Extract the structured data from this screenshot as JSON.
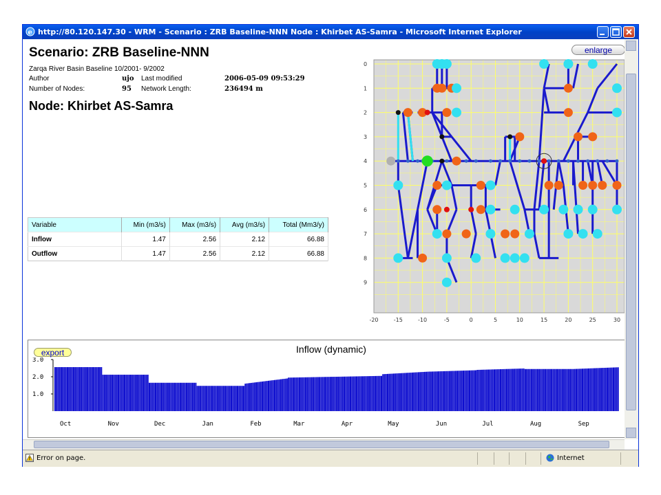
{
  "window": {
    "title": "http://80.120.147.30 - WRM - Scenario : ZRB Baseline-NNN Node : Khirbet AS-Samra - Microsoft Internet Explorer"
  },
  "scenario": {
    "heading": "Scenario: ZRB Baseline-NNN",
    "subtitle": "Zarqa River Basin Baseline 10/2001- 9/2002",
    "author_label": "Author",
    "author": "ujo",
    "last_modified_label": "Last modified",
    "last_modified": "2006-05-09 09:53:29",
    "nodes_label": "Number of Nodes:",
    "nodes": "95",
    "network_length_label": "Network Length:",
    "network_length": "236494 m"
  },
  "node": {
    "heading": "Node: Khirbet AS-Samra"
  },
  "stats_table": {
    "headers": [
      "Variable",
      "Min (m3/s)",
      "Max (m3/s)",
      "Avg (m3/s)",
      "Total (Mm3/y)"
    ],
    "rows": [
      [
        "Inflow",
        "1.47",
        "2.56",
        "2.12",
        "66.88"
      ],
      [
        "Outflow",
        "1.47",
        "2.56",
        "2.12",
        "66.88"
      ]
    ]
  },
  "map": {
    "enlarge_label": "enlarge",
    "x_ticks": [
      "-20",
      "-15",
      "-10",
      "-5",
      "0",
      "5",
      "10",
      "15",
      "20",
      "25",
      "30"
    ],
    "y_ticks": [
      "0",
      "1",
      "2",
      "3",
      "4",
      "5",
      "6",
      "7",
      "8",
      "9"
    ],
    "colors": {
      "background": "#d9d9d9",
      "grid": "#ffff66",
      "link": "#1a1acc",
      "junction": "#3366cc",
      "cyan_node": "#33e0f0",
      "orange_node": "#f06418",
      "red_node": "#e01010",
      "green_node": "#22dd22",
      "black_node": "#111111",
      "gray_node": "#b0b0b0"
    }
  },
  "chart_data": {
    "type": "bar",
    "title": "Inflow (dynamic)",
    "export_label": "export",
    "ylim": [
      0,
      3.0
    ],
    "y_ticks": [
      "3.0",
      "2.0",
      "1.0"
    ],
    "x_tick_labels": [
      "Oct",
      "Nov",
      "Dec",
      "Jan",
      "Feb",
      "Mar",
      "Apr",
      "May",
      "Jun",
      "Jul",
      "Aug",
      "Sep"
    ],
    "bar_color": "#0000cc",
    "segments": [
      {
        "days": 31,
        "start": 2.56,
        "end": 2.56
      },
      {
        "days": 30,
        "start": 2.12,
        "end": 2.12
      },
      {
        "days": 31,
        "start": 1.65,
        "end": 1.65
      },
      {
        "days": 31,
        "start": 1.47,
        "end": 1.47
      },
      {
        "days": 28,
        "start": 1.6,
        "end": 1.9
      },
      {
        "days": 31,
        "start": 1.95,
        "end": 2.0
      },
      {
        "days": 30,
        "start": 2.0,
        "end": 2.05
      },
      {
        "days": 31,
        "start": 2.15,
        "end": 2.3
      },
      {
        "days": 30,
        "start": 2.3,
        "end": 2.38
      },
      {
        "days": 31,
        "start": 2.4,
        "end": 2.48
      },
      {
        "days": 31,
        "start": 2.45,
        "end": 2.45
      },
      {
        "days": 30,
        "start": 2.45,
        "end": 2.55
      }
    ]
  },
  "status": {
    "text": "Error on page.",
    "zone": "Internet"
  }
}
